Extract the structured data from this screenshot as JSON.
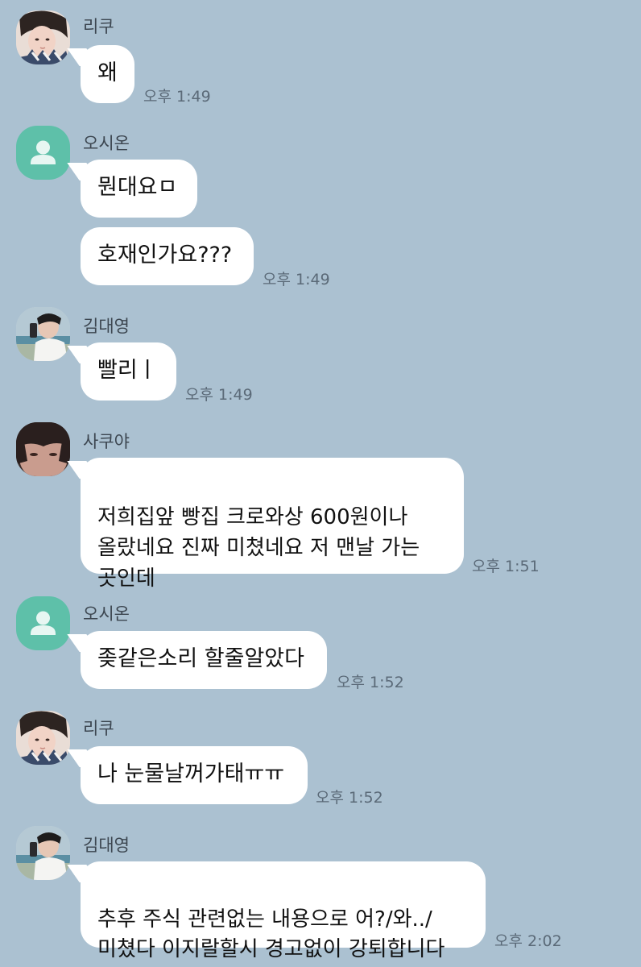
{
  "messages": [
    {
      "sender": "리쿠",
      "avatar": "photo-avatar-riku",
      "bubbles": [
        "왜"
      ],
      "time": "오후 1:49"
    },
    {
      "sender": "오시온",
      "avatar": "default-person-icon",
      "bubbles": [
        "뭔대요ㅁ",
        "호재인가요???"
      ],
      "time": "오후 1:49"
    },
    {
      "sender": "김대영",
      "avatar": "photo-avatar-kim",
      "bubbles": [
        "빨리ㅣ"
      ],
      "time": "오후 1:49"
    },
    {
      "sender": "사쿠야",
      "avatar": "photo-avatar-sakuya",
      "bubbles": [
        "저희집앞 빵집 크로와상 600원이나\n올랐네요 진짜 미쳤네요 저 맨날 가는\n곳인데"
      ],
      "time": "오후 1:51"
    },
    {
      "sender": "오시온",
      "avatar": "default-person-icon",
      "bubbles": [
        "좆같은소리 할줄알았다"
      ],
      "time": "오후 1:52"
    },
    {
      "sender": "리쿠",
      "avatar": "photo-avatar-riku",
      "bubbles": [
        "나 눈물날꺼가태ㅠㅠ"
      ],
      "time": "오후 1:52"
    },
    {
      "sender": "김대영",
      "avatar": "photo-avatar-kim",
      "bubbles": [
        "추후 주식 관련없는 내용으로 어?/와../\n미쳤다 이지랄할시 경고없이 강퇴합니다"
      ],
      "time": "오후 2:02"
    }
  ],
  "colors": {
    "background": "#abc1d1",
    "bubble": "#ffffff",
    "default_avatar": "#5ec0a9",
    "time_text": "#5b6a78"
  }
}
